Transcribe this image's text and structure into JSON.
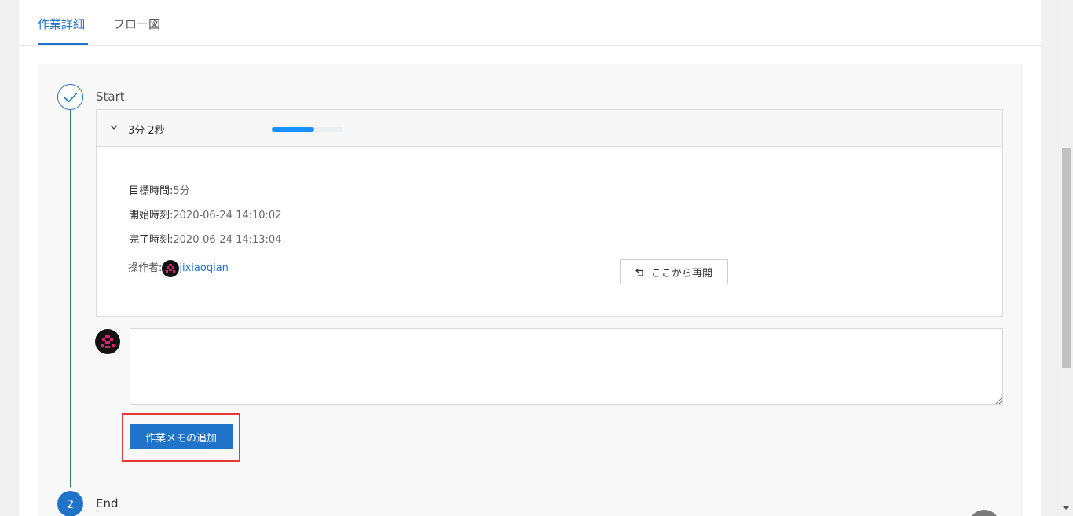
{
  "tabs": [
    {
      "label": "作業詳細",
      "active": true
    },
    {
      "label": "フロー図",
      "active": false
    }
  ],
  "steps": {
    "start_label": "Start",
    "end_label": "End",
    "end_number": "2"
  },
  "card": {
    "duration": "3分 2秒",
    "progress_fraction": 0.6,
    "target_label": "目標時間:",
    "target_value": "5分",
    "start_label": "開始時刻:",
    "start_value": "2020-06-24 14:10:02",
    "end_label": "完了時刻:",
    "end_value": "2020-06-24 14:13:04",
    "operator_label": "操作者:",
    "operator_name": "jixiaoqian",
    "resume_label": "ここから再開"
  },
  "comment": {
    "placeholder": "",
    "add_button_label": "作業メモの追加"
  },
  "colors": {
    "accent": "#1f73c9",
    "timeline": "#2e7d62",
    "highlight": "#e53935",
    "progress": "#1890ff"
  },
  "icons": [
    "check-icon",
    "chevron-down-icon",
    "undo-icon",
    "arrow-to-top-icon",
    "avatar-icon"
  ]
}
